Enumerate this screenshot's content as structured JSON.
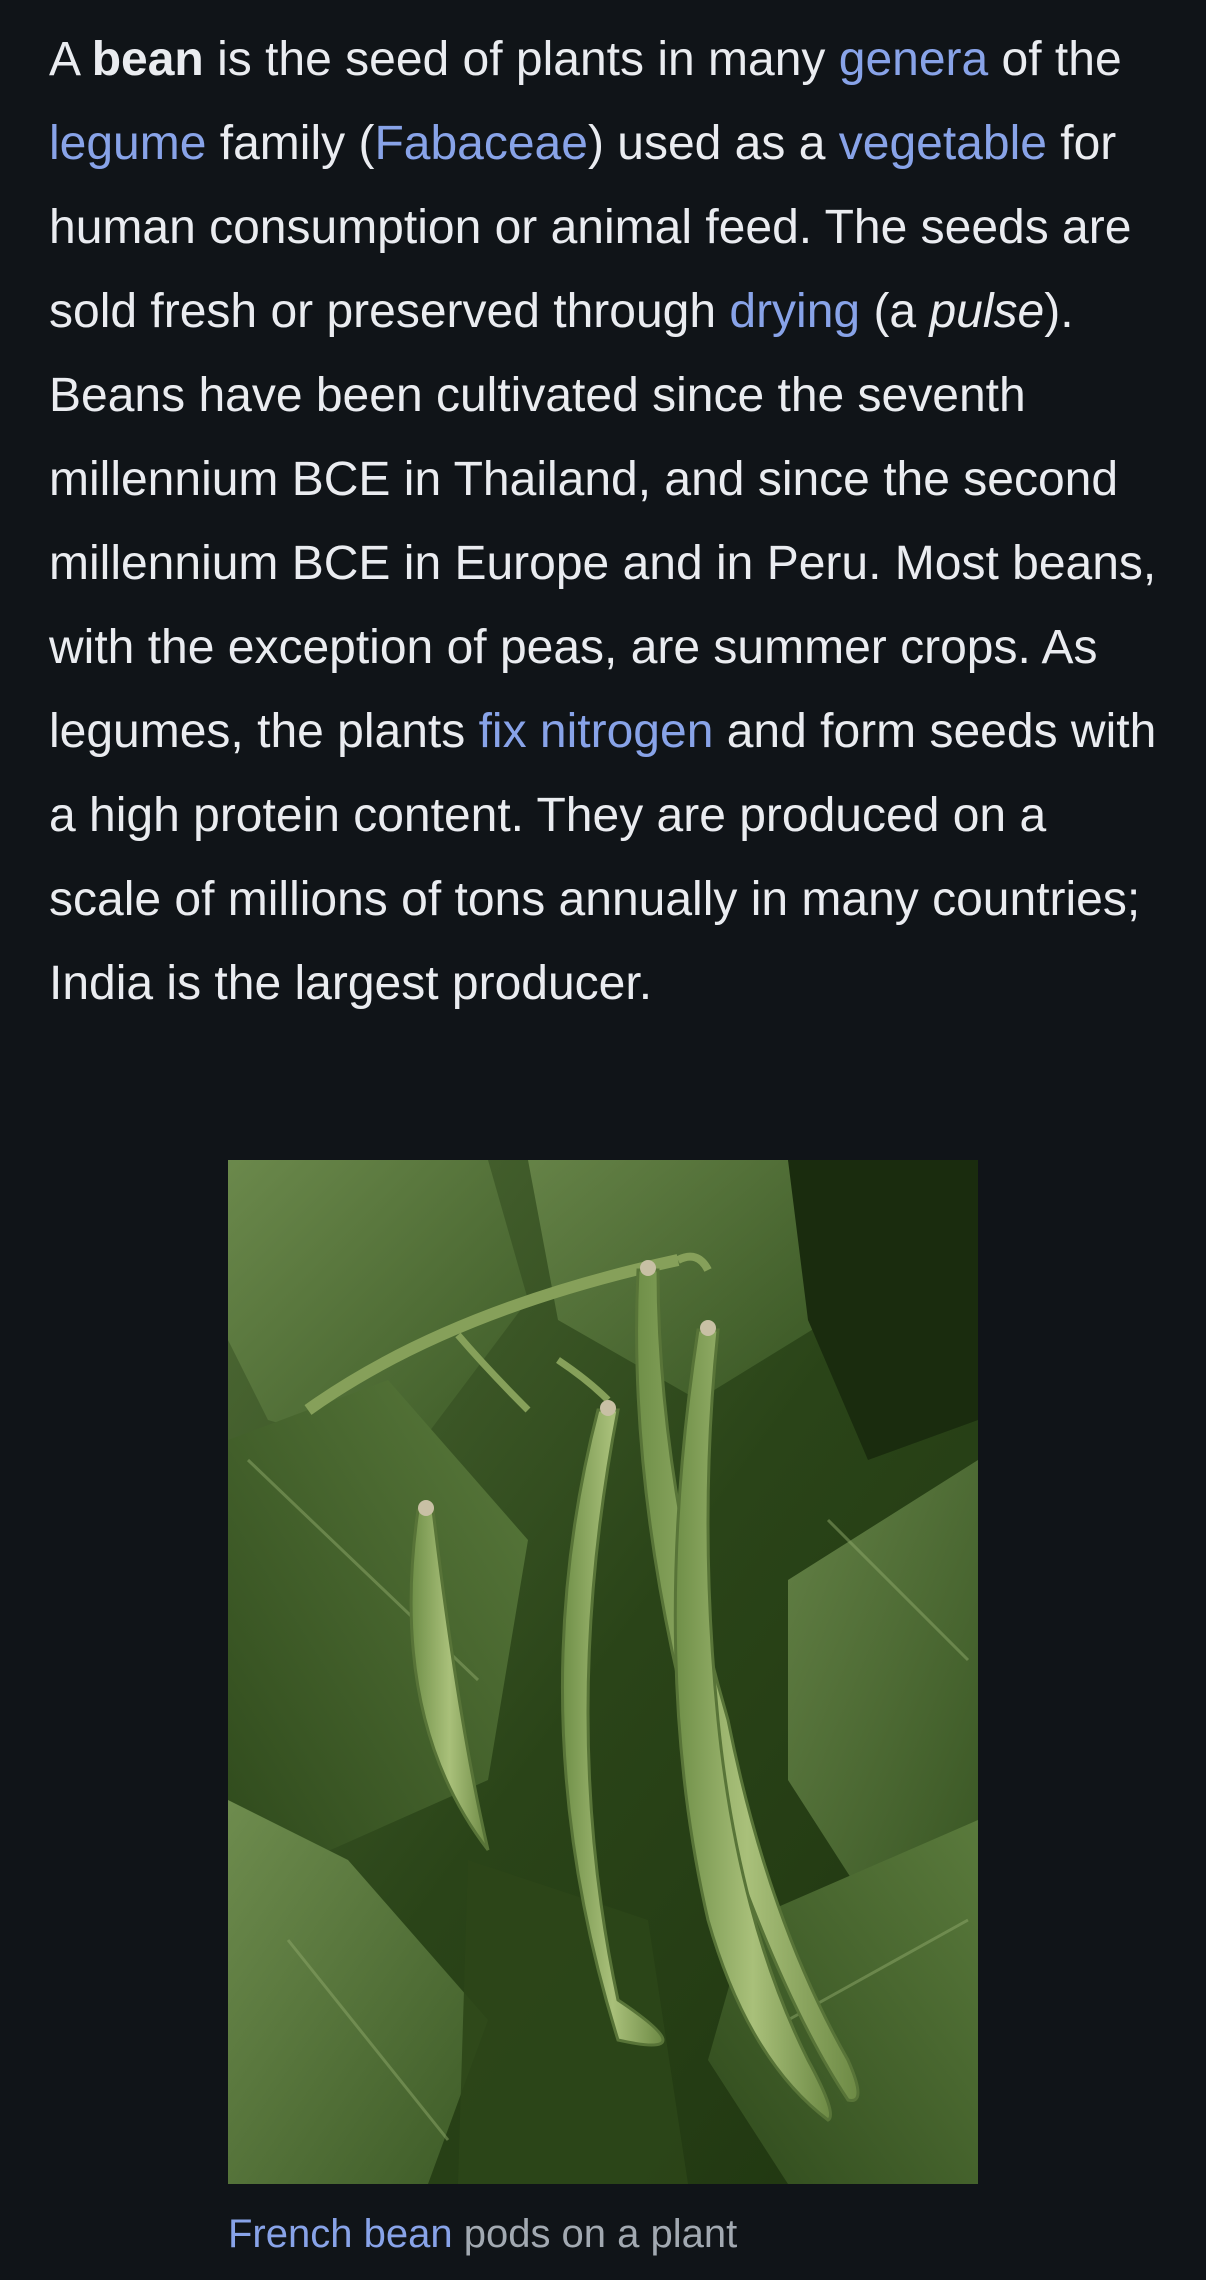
{
  "article": {
    "t1": "A ",
    "bold_term": "bean",
    "t2": " is the seed of plants in many ",
    "link_genera": "genera",
    "t3": " of the ",
    "link_legume": "legume",
    "t4": " family (",
    "link_fabaceae": "Fabaceae",
    "t5": ") used as a ",
    "link_vegetable": "vegetable",
    "t6": " for human consumption or animal feed. The seeds are sold fresh or preserved through ",
    "link_drying": "drying",
    "t7": " (a ",
    "italic_pulse": "pulse",
    "t8": "). Beans have been cultivated since the seventh millennium BCE in Thailand, and since the second millennium BCE in Europe and in Peru. Most beans, with the exception of peas, are summer crops. As legumes, the plants ",
    "link_fix_nitrogen": "fix nitrogen",
    "t9": " and form seeds with a high protein content. They are produced on a scale of millions of tons annually in many countries; India is the largest producer."
  },
  "figure": {
    "caption_link": "French bean",
    "caption_text": " pods on a plant"
  },
  "colors": {
    "background": "#101418",
    "text": "#eaecf0",
    "link": "#88a3e8",
    "caption": "#a2a9b1"
  }
}
